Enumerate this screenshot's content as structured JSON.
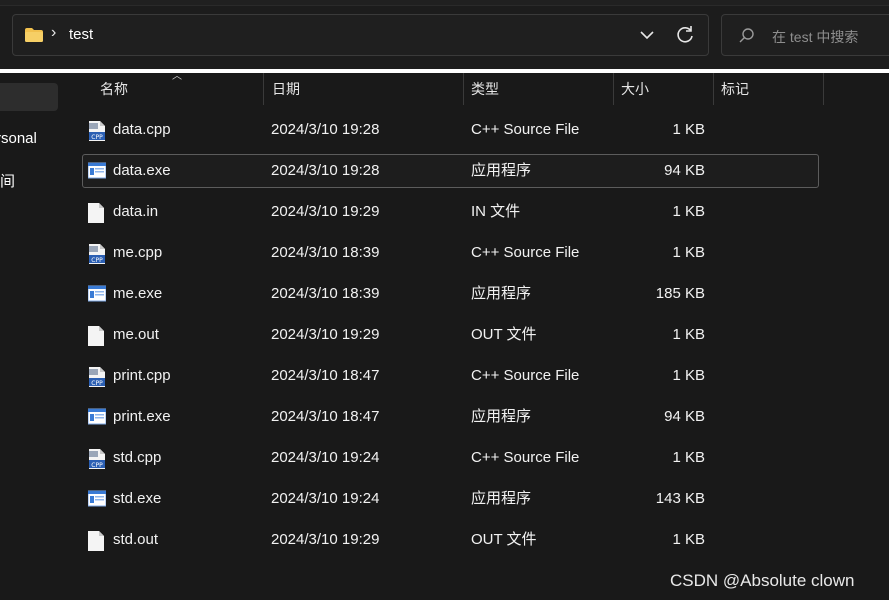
{
  "address": {
    "path": "test",
    "search_placeholder": "在 test 中搜索"
  },
  "nav": {
    "item1": "rsonal",
    "item2": "间"
  },
  "columns": {
    "name": "名称",
    "date": "日期",
    "type": "类型",
    "size": "大小",
    "tags": "标记"
  },
  "files": [
    {
      "name": "data.cpp",
      "date": "2024/3/10 19:28",
      "type": "C++ Source File",
      "size": "1 KB",
      "icon": "cpp-file-icon"
    },
    {
      "name": "data.exe",
      "date": "2024/3/10 19:28",
      "type": "应用程序",
      "size": "94 KB",
      "icon": "exe-file-icon"
    },
    {
      "name": "data.in",
      "date": "2024/3/10 19:29",
      "type": "IN 文件",
      "size": "1 KB",
      "icon": "blank-file-icon"
    },
    {
      "name": "me.cpp",
      "date": "2024/3/10 18:39",
      "type": "C++ Source File",
      "size": "1 KB",
      "icon": "cpp-file-icon"
    },
    {
      "name": "me.exe",
      "date": "2024/3/10 18:39",
      "type": "应用程序",
      "size": "185 KB",
      "icon": "exe-file-icon"
    },
    {
      "name": "me.out",
      "date": "2024/3/10 19:29",
      "type": "OUT 文件",
      "size": "1 KB",
      "icon": "blank-file-icon"
    },
    {
      "name": "print.cpp",
      "date": "2024/3/10 18:47",
      "type": "C++ Source File",
      "size": "1 KB",
      "icon": "cpp-file-icon"
    },
    {
      "name": "print.exe",
      "date": "2024/3/10 18:47",
      "type": "应用程序",
      "size": "94 KB",
      "icon": "exe-file-icon"
    },
    {
      "name": "std.cpp",
      "date": "2024/3/10 19:24",
      "type": "C++ Source File",
      "size": "1 KB",
      "icon": "cpp-file-icon"
    },
    {
      "name": "std.exe",
      "date": "2024/3/10 19:24",
      "type": "应用程序",
      "size": "143 KB",
      "icon": "exe-file-icon"
    },
    {
      "name": "std.out",
      "date": "2024/3/10 19:29",
      "type": "OUT 文件",
      "size": "1 KB",
      "icon": "blank-file-icon"
    }
  ],
  "selected_file": "data.exe",
  "watermark": "CSDN @Absolute clown",
  "colors": {
    "background": "#191919",
    "folder": "#f2c14e",
    "exe_blue": "#3a7bd5",
    "cpp_blue": "#2b5fb3"
  }
}
